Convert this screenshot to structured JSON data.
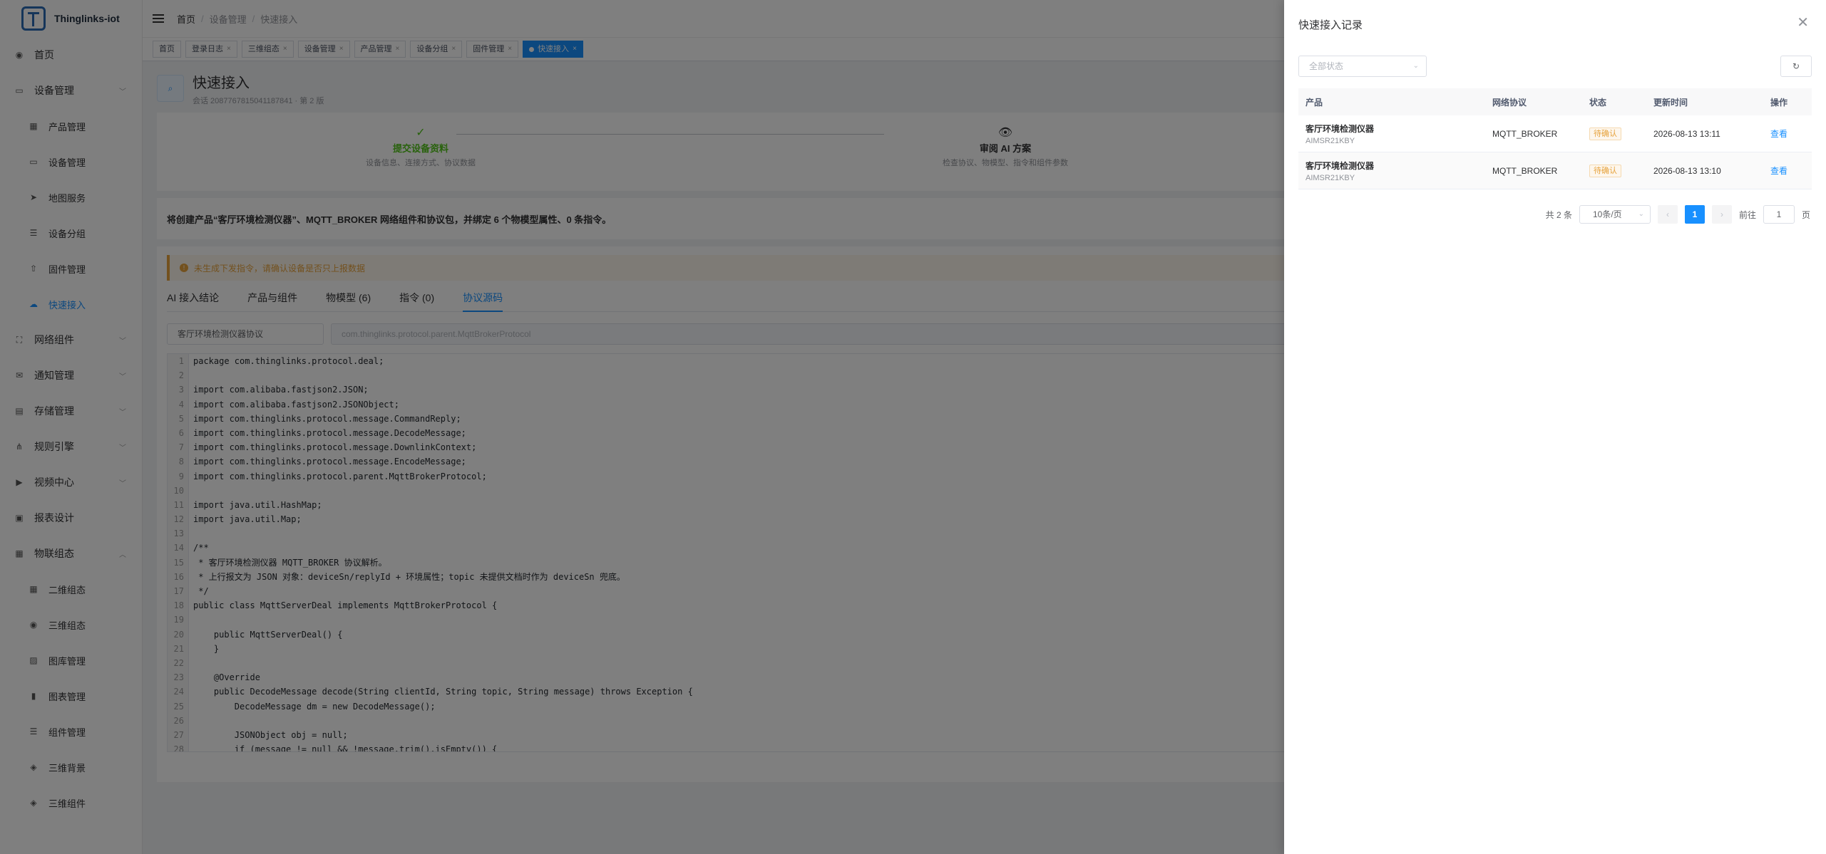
{
  "app": {
    "name": "Thinglinks-iot"
  },
  "sidebar": {
    "items": [
      {
        "label": "首页",
        "icon": "dashboard-icon",
        "sub": false,
        "expand": false
      },
      {
        "label": "设备管理",
        "icon": "monitor-icon",
        "sub": false,
        "expand": true
      },
      {
        "label": "产品管理",
        "icon": "grid-icon",
        "sub": true,
        "expand": false
      },
      {
        "label": "设备管理",
        "icon": "monitor-icon",
        "sub": true,
        "expand": false
      },
      {
        "label": "地图服务",
        "icon": "send-icon",
        "sub": true,
        "expand": false
      },
      {
        "label": "设备分组",
        "icon": "list-icon",
        "sub": true,
        "expand": false
      },
      {
        "label": "固件管理",
        "icon": "upload-icon",
        "sub": true,
        "expand": false
      },
      {
        "label": "快速接入",
        "icon": "cloud-icon",
        "sub": true,
        "expand": false,
        "active": true
      },
      {
        "label": "网络组件",
        "icon": "network-icon",
        "sub": false,
        "expand": true
      },
      {
        "label": "通知管理",
        "icon": "message-icon",
        "sub": false,
        "expand": true
      },
      {
        "label": "存储管理",
        "icon": "storage-icon",
        "sub": false,
        "expand": true
      },
      {
        "label": "规则引擎",
        "icon": "tree-icon",
        "sub": false,
        "expand": true
      },
      {
        "label": "视频中心",
        "icon": "video-icon",
        "sub": false,
        "expand": true
      },
      {
        "label": "报表设计",
        "icon": "report-icon",
        "sub": false,
        "expand": false
      },
      {
        "label": "物联组态",
        "icon": "grid-icon",
        "sub": false,
        "expand": true,
        "open": true
      },
      {
        "label": "二维组态",
        "icon": "grid-icon",
        "sub": true,
        "expand": false
      },
      {
        "label": "三维组态",
        "icon": "dashboard-icon",
        "sub": true,
        "expand": false
      },
      {
        "label": "图库管理",
        "icon": "image-icon",
        "sub": true,
        "expand": false
      },
      {
        "label": "图表管理",
        "icon": "chart-icon",
        "sub": true,
        "expand": false
      },
      {
        "label": "组件管理",
        "icon": "list-icon",
        "sub": true,
        "expand": false
      },
      {
        "label": "三维背景",
        "icon": "cube-icon",
        "sub": true,
        "expand": false
      },
      {
        "label": "三维组件",
        "icon": "cube-icon",
        "sub": true,
        "expand": false
      }
    ]
  },
  "breadcrumb": [
    "首页",
    "设备管理",
    "快速接入"
  ],
  "tags": [
    {
      "label": "首页",
      "closable": false,
      "active": false
    },
    {
      "label": "登录日志",
      "closable": true,
      "active": false
    },
    {
      "label": "三维组态",
      "closable": true,
      "active": false
    },
    {
      "label": "设备管理",
      "closable": true,
      "active": false
    },
    {
      "label": "产品管理",
      "closable": true,
      "active": false
    },
    {
      "label": "设备分组",
      "closable": true,
      "active": false
    },
    {
      "label": "固件管理",
      "closable": true,
      "active": false
    },
    {
      "label": "快速接入",
      "closable": true,
      "active": true
    }
  ],
  "page": {
    "title": "快速接入",
    "subtitle": "会话 2087767815041187841 · 第 2 版",
    "steps": [
      {
        "name": "提交设备资料",
        "desc": "设备信息、连接方式、协议数据",
        "mark": "✓",
        "color": "#52c41a"
      },
      {
        "name": "审阅 AI 方案",
        "desc": "检查协议、物模型、指令和组件参数",
        "mark": "👁",
        "color": "#303133"
      }
    ],
    "summary": "将创建产品“客厅环境检测仪器”、MQTT_BROKER 网络组件和协议包，并绑定 6 个物模型属性、0 条指令。",
    "warning": "未生成下发指令，请确认设备是否只上报数据",
    "tabs": [
      "AI 接入结论",
      "产品与组件",
      "物模型 (6)",
      "指令 (0)",
      "协议源码"
    ],
    "active_tab": 4,
    "protocol_name": "客厅环境检测仪器协议",
    "protocol_class": "com.thinglinks.protocol.parent.MqttBrokerProtocol",
    "code_lines": [
      "package com.thinglinks.protocol.deal;",
      "",
      "import com.alibaba.fastjson2.JSON;",
      "import com.alibaba.fastjson2.JSONObject;",
      "import com.thinglinks.protocol.message.CommandReply;",
      "import com.thinglinks.protocol.message.DecodeMessage;",
      "import com.thinglinks.protocol.message.DownlinkContext;",
      "import com.thinglinks.protocol.message.EncodeMessage;",
      "import com.thinglinks.protocol.parent.MqttBrokerProtocol;",
      "",
      "import java.util.HashMap;",
      "import java.util.Map;",
      "",
      "/**",
      " * 客厅环境检测仪器 MQTT_BROKER 协议解析。",
      " * 上行报文为 JSON 对象：deviceSn/replyId + 环境属性；topic 未提供文档时作为 deviceSn 兜底。",
      " */",
      "public class MqttServerDeal implements MqttBrokerProtocol {",
      "",
      "    public MqttServerDeal() {",
      "    }",
      "",
      "    @Override",
      "    public DecodeMessage decode(String clientId, String topic, String message) throws Exception {",
      "        DecodeMessage dm = new DecodeMessage();",
      "",
      "        JSONObject obj = null;",
      "        if (message != null && !message.trim().isEmpty()) {"
    ]
  },
  "drawer": {
    "title": "快速接入记录",
    "filter_placeholder": "全部状态",
    "columns": [
      "产品",
      "网络协议",
      "状态",
      "更新时间",
      "操作"
    ],
    "rows": [
      {
        "product": "客厅环境检测仪器",
        "code": "AIMSR21KBY",
        "protocol": "MQTT_BROKER",
        "status": "待确认",
        "time": "2026-08-13 13:11",
        "action": "查看"
      },
      {
        "product": "客厅环境检测仪器",
        "code": "AIMSR21KBY",
        "protocol": "MQTT_BROKER",
        "status": "待确认",
        "time": "2026-08-13 13:10",
        "action": "查看"
      }
    ],
    "pager": {
      "total": "共 2 条",
      "size": "10条/页",
      "current": "1",
      "goto_prefix": "前往",
      "goto_value": "1",
      "goto_suffix": "页"
    }
  },
  "colors": {
    "primary": "#1890ff",
    "warning": "#e6a23c",
    "success": "#52c41a"
  }
}
